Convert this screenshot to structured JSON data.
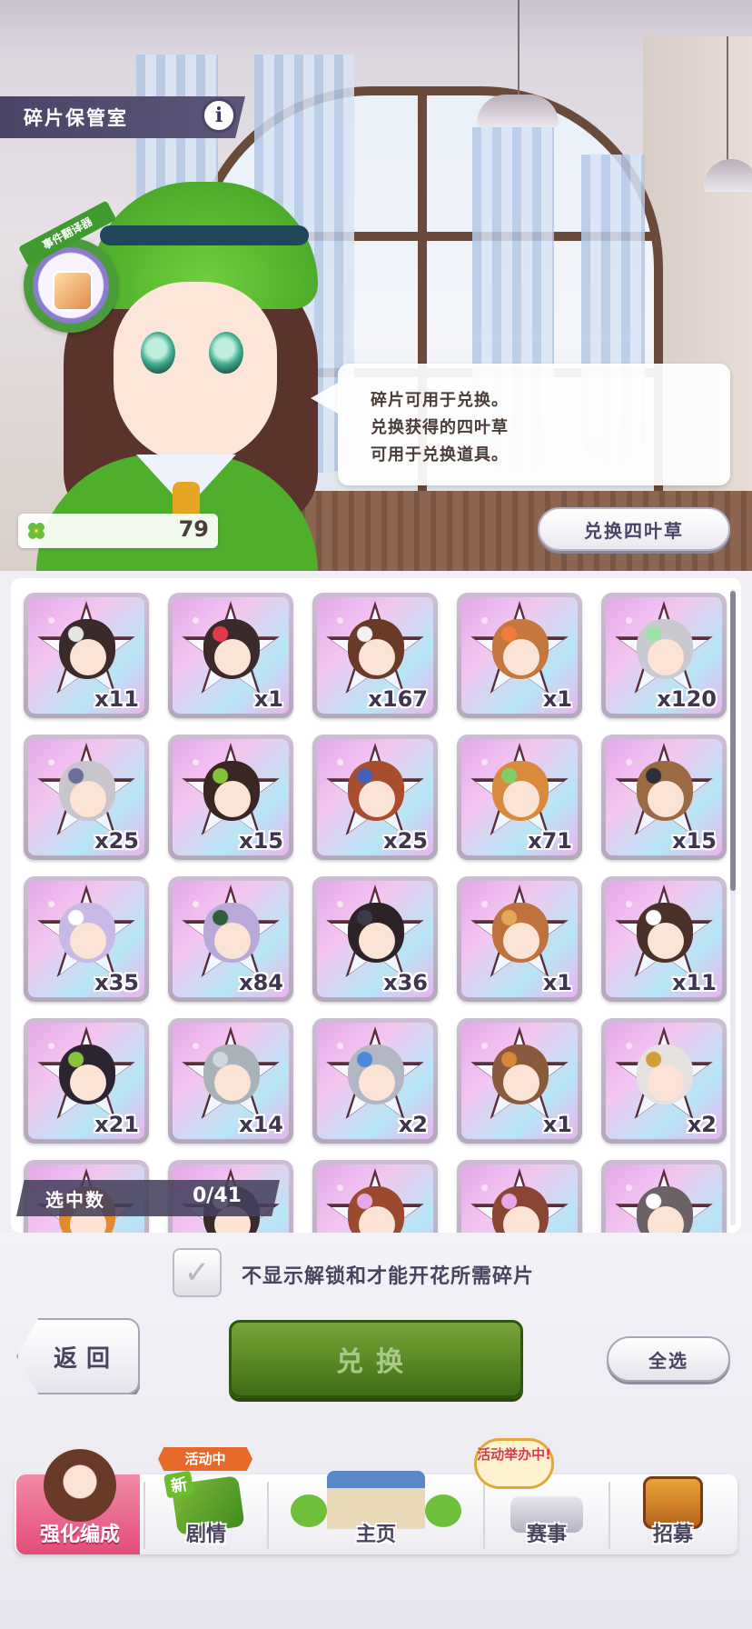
{
  "header": {
    "title": "碎片保管室",
    "info_icon": "i"
  },
  "badge": {
    "ribbon": "事件翻译器"
  },
  "speech": {
    "lines": [
      "碎片可用于兑换。",
      "兑换获得的四叶草",
      "可用于兑换道具。"
    ]
  },
  "clover": {
    "count": "79"
  },
  "exchange_clover_button": "兑换四叶草",
  "grid": {
    "cards": [
      {
        "count": "x11",
        "hair": "#3b2a2a",
        "accent": "#e6e6e6"
      },
      {
        "count": "x1",
        "hair": "#3a2a2a",
        "accent": "#e33a4a"
      },
      {
        "count": "x167",
        "hair": "#6a3a28",
        "accent": "#f2f2f2"
      },
      {
        "count": "x1",
        "hair": "#c6773e",
        "accent": "#f27a3a"
      },
      {
        "count": "x120",
        "hair": "#c9c9cf",
        "accent": "#9be4a8"
      },
      {
        "count": "x25",
        "hair": "#c8c5cc",
        "accent": "#6b6f9a"
      },
      {
        "count": "x15",
        "hair": "#3a2622",
        "accent": "#84c23a"
      },
      {
        "count": "x25",
        "hair": "#a74e2e",
        "accent": "#4460b8"
      },
      {
        "count": "x71",
        "hair": "#d98a3c",
        "accent": "#7fcf6a"
      },
      {
        "count": "x15",
        "hair": "#9a6a42",
        "accent": "#2f2f3a"
      },
      {
        "count": "x35",
        "hair": "#c8b9e6",
        "accent": "#ffffff"
      },
      {
        "count": "x84",
        "hair": "#b9a8d8",
        "accent": "#2f5e3a"
      },
      {
        "count": "x36",
        "hair": "#2c2228",
        "accent": "#3a3a4a"
      },
      {
        "count": "x1",
        "hair": "#c0723c",
        "accent": "#e3a75a"
      },
      {
        "count": "x11",
        "hair": "#4a3028",
        "accent": "#ffffff"
      },
      {
        "count": "x21",
        "hair": "#2d2432",
        "accent": "#8ac23a"
      },
      {
        "count": "x14",
        "hair": "#a9b2b8",
        "accent": "#cfd8de"
      },
      {
        "count": "x2",
        "hair": "#b3b6c4",
        "accent": "#4a8ad8"
      },
      {
        "count": "x1",
        "hair": "#8a5a3c",
        "accent": "#d8863a"
      },
      {
        "count": "x2",
        "hair": "#e6e2e0",
        "accent": "#d0a038"
      },
      {
        "count": "",
        "hair": "#e58a2c",
        "accent": "#ffcf6a"
      },
      {
        "count": "",
        "hair": "#3a2a2a",
        "accent": "#ffffff"
      },
      {
        "count": "",
        "hair": "#9a4a2e",
        "accent": "#e6a8ea"
      },
      {
        "count": "",
        "hair": "#8a4632",
        "accent": "#e6a8ea"
      },
      {
        "count": "",
        "hair": "#6a6266",
        "accent": "#ffffff"
      }
    ]
  },
  "selection": {
    "label": "选中数",
    "value": "0/41"
  },
  "filter_checkbox": {
    "label": "不显示解锁和才能开花所需碎片",
    "checked_glyph": "✓"
  },
  "buttons": {
    "back": "返回",
    "exchange": "兑换",
    "select_all": "全选"
  },
  "nav": {
    "items": [
      {
        "label": "强化编成",
        "active": true
      },
      {
        "label": "剧情",
        "active": false
      },
      {
        "label": "主页",
        "active": false
      },
      {
        "label": "赛事",
        "active": false
      },
      {
        "label": "招募",
        "active": false
      }
    ],
    "tag_event": "活动中",
    "tag_new": "新",
    "tag_live": "活动举办中!"
  },
  "colors": {
    "accent_green": "#5c8a25",
    "nav_active": "#e34c79",
    "header_tab": "#4a4566"
  }
}
